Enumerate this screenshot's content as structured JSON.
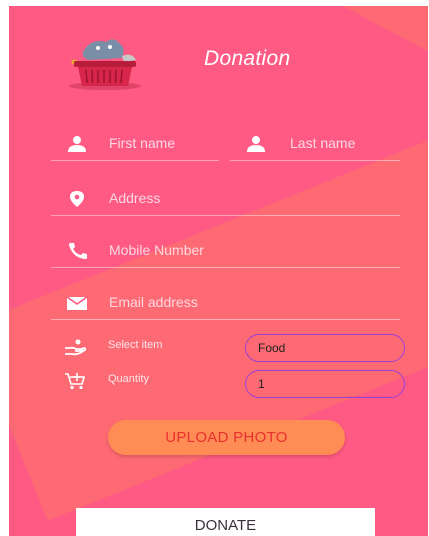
{
  "header": {
    "title": "Donation",
    "logo_icon": "basket-logo-icon"
  },
  "form": {
    "first_name": {
      "placeholder": "First name",
      "icon": "person-icon"
    },
    "last_name": {
      "placeholder": "Last name",
      "icon": "person-icon"
    },
    "address": {
      "placeholder": "Address",
      "icon": "location-pin-icon"
    },
    "mobile": {
      "placeholder": "Mobile Number",
      "icon": "phone-icon"
    },
    "email": {
      "placeholder": "Email address",
      "icon": "mail-icon"
    },
    "select_item": {
      "label": "Select item",
      "value": "Food",
      "icon": "hand-give-icon"
    },
    "quantity": {
      "label": "Quantity",
      "value": "1",
      "icon": "cart-add-icon"
    }
  },
  "buttons": {
    "upload_label": "UPLOAD PHOTO",
    "donate_label": "DONATE"
  },
  "colors": {
    "background": "#fe5a84",
    "accent_band": "#fe6a73",
    "upload_button": "#ff8c55",
    "upload_text": "#e8302e",
    "pill_border": "#9c3fd6"
  }
}
